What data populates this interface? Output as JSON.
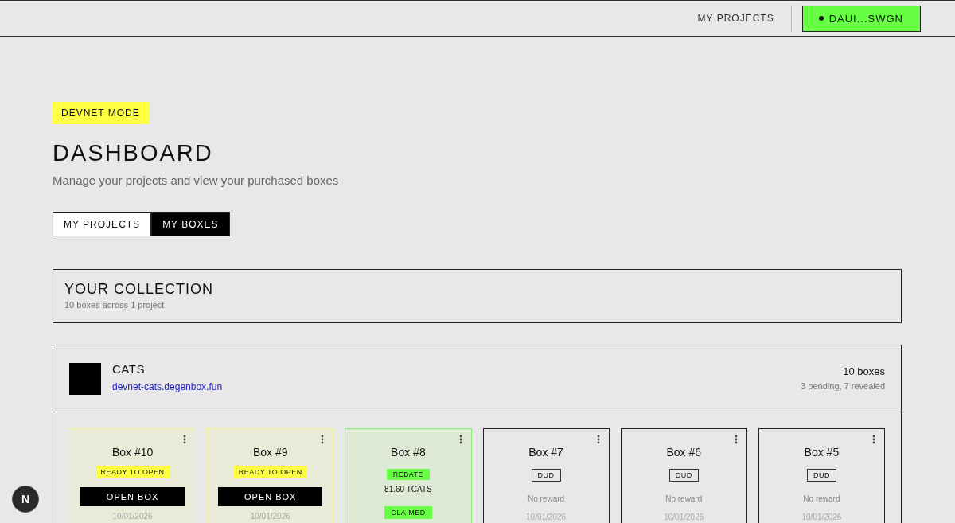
{
  "header": {
    "nav_link": "MY PROJECTS",
    "wallet_label": "DAUI...SWGN"
  },
  "mode_badge": "DEVNET MODE",
  "page": {
    "title": "DASHBOARD",
    "subtitle": "Manage your projects and view your purchased boxes"
  },
  "tabs": [
    {
      "label": "MY PROJECTS",
      "selected": false
    },
    {
      "label": "MY BOXES",
      "selected": true
    }
  ],
  "collection": {
    "title": "YOUR COLLECTION",
    "summary": "10 boxes across 1 project"
  },
  "projects": [
    {
      "name": "CATS",
      "url": "devnet-cats.degenbox.fun",
      "box_count": "10 boxes",
      "status_summary": "3 pending, 7 revealed",
      "boxes": [
        {
          "kind": "ready",
          "title": "Box #10",
          "badge": "READY TO OPEN",
          "button": "OPEN BOX",
          "date": "10/01/2026"
        },
        {
          "kind": "ready",
          "title": "Box #9",
          "badge": "READY TO OPEN",
          "button": "OPEN BOX",
          "date": "10/01/2026"
        },
        {
          "kind": "rebate",
          "title": "Box #8",
          "badge": "REBATE",
          "reward": "81.60 TCATS",
          "claim_badge": "CLAIMED"
        },
        {
          "kind": "dud",
          "title": "Box #7",
          "badge": "DUD",
          "reward": "No reward",
          "date": "10/01/2026"
        },
        {
          "kind": "dud",
          "title": "Box #6",
          "badge": "DUD",
          "reward": "No reward",
          "date": "10/01/2026"
        },
        {
          "kind": "dud",
          "title": "Box #5",
          "badge": "DUD",
          "reward": "No reward",
          "date": "10/01/2026"
        }
      ]
    }
  ],
  "dev_indicator": {
    "label": "N"
  }
}
